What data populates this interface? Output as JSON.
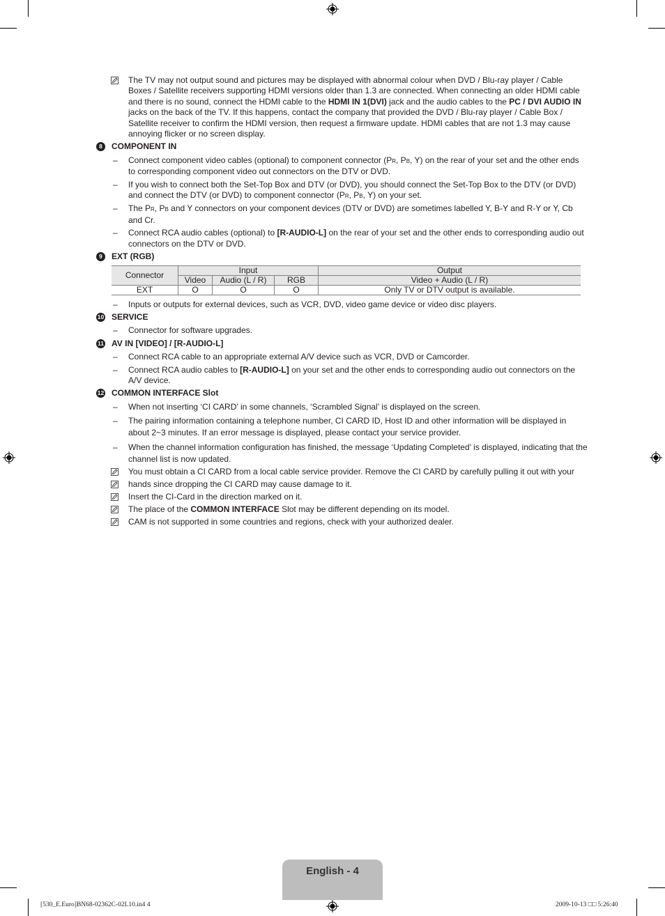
{
  "intro_note": {
    "icon": "note-icon",
    "parts": [
      {
        "t": "The TV may not output sound and pictures may be displayed with abnormal colour when DVD / Blu-ray player / Cable Boxes / Satellite receivers supporting HDMI versions older than 1.3 are connected. When connecting an older HDMI cable and there is no sound, connect the HDMI cable to the "
      },
      {
        "b": "HDMI IN 1(DVI)"
      },
      {
        "t": " jack and the audio cables to the "
      },
      {
        "b": "PC / DVI AUDIO IN"
      },
      {
        "t": " jacks on the back of the TV. If this happens, contact the company that provided the DVD / Blu-ray player / Cable Box / Satellite receiver to confirm the HDMI version, then request a firmware update. HDMI cables that are not 1.3 may cause annoying flicker or no screen display."
      }
    ]
  },
  "sections": {
    "component": {
      "number": "8",
      "title": "COMPONENT IN",
      "items": {
        "i0a": "Connect component video cables (optional) to component connector (P",
        "i0b": ", P",
        "i0c": ", Y) on the rear of your set and the other ends to corresponding component video out connectors on the DTV or DVD.",
        "i1a": "If you wish to connect both the Set-Top Box and DTV (or DVD), you should connect the Set-Top Box to the DTV (or DVD) and connect the DTV (or DVD) to component connector (P",
        "i1b": ", P",
        "i1c": ", Y) on your set.",
        "i2a": "The P",
        "i2b": ", P",
        "i2c": " and Y connectors on your component devices (DTV or DVD) are sometimes labelled Y, B-Y and R-Y or Y, Cb and Cr.",
        "i3a": "Connect RCA audio cables (optional) to ",
        "i3b": "[R-AUDIO-L]",
        "i3c": " on the rear of your set and the other ends to corresponding audio out connectors on the DTV or DVD.",
        "sub_r": "R",
        "sub_b": "B"
      }
    },
    "ext": {
      "number": "9",
      "title": "EXT (RGB)",
      "table": {
        "h_connector": "Connector",
        "h_input": "Input",
        "h_output": "Output",
        "h_video": "Video",
        "h_audio": "Audio (L / R)",
        "h_rgb": "RGB",
        "h_out": "Video + Audio (L / R)",
        "rows": [
          {
            "connector": "EXT",
            "video": "O",
            "audio": "O",
            "rgb": "O",
            "output": "Only TV or DTV output is available."
          }
        ]
      },
      "item": "Inputs or outputs for external devices, such as VCR, DVD, video game device or video disc players."
    },
    "service": {
      "number": "10",
      "title": "SERVICE",
      "item": "Connector for software upgrades."
    },
    "avin": {
      "number": "11",
      "title": "AV IN [VIDEO] / [R-AUDIO-L]",
      "i0": "Connect RCA cable to an appropriate external A/V device such as VCR, DVD or Camcorder.",
      "i1a": "Connect RCA audio cables to ",
      "i1b": "[R-AUDIO-L]",
      "i1c": " on your set and the other ends to corresponding audio out connectors on the A/V device."
    },
    "ci": {
      "number": "12",
      "title": "COMMON INTERFACE Slot",
      "d0": "When not inserting ‘CI CARD’ in some channels, ‘Scrambled Signal’ is displayed on the screen.",
      "d1": "The pairing information containing a telephone number, CI CARD ID, Host ID and other information will be displayed in about 2~3 minutes. If an error message is displayed, please contact your service provider.",
      "d2": "When the channel information configuration has finished, the message ‘Updating Completed’ is displayed, indicating that the channel list is now updated.",
      "n0": "You must obtain a CI CARD from a local cable service provider. Remove the CI CARD by carefully pulling it out with your",
      "n1": "hands since dropping the CI CARD may cause damage to it.",
      "n2": "Insert the CI-Card in the direction marked on it.",
      "n3a": "The place of the ",
      "n3b": "COMMON INTERFACE",
      "n3c": " Slot may be different depending on its model.",
      "n4": "CAM is not supported in some countries and regions, check with your authorized dealer."
    }
  },
  "page_label": "English - 4",
  "footer": {
    "file": "[530_E.Euro]BN68-02362C-02L10.in4   4",
    "date": "2009-10-13   □□ 5:26:40"
  },
  "dash": "–"
}
